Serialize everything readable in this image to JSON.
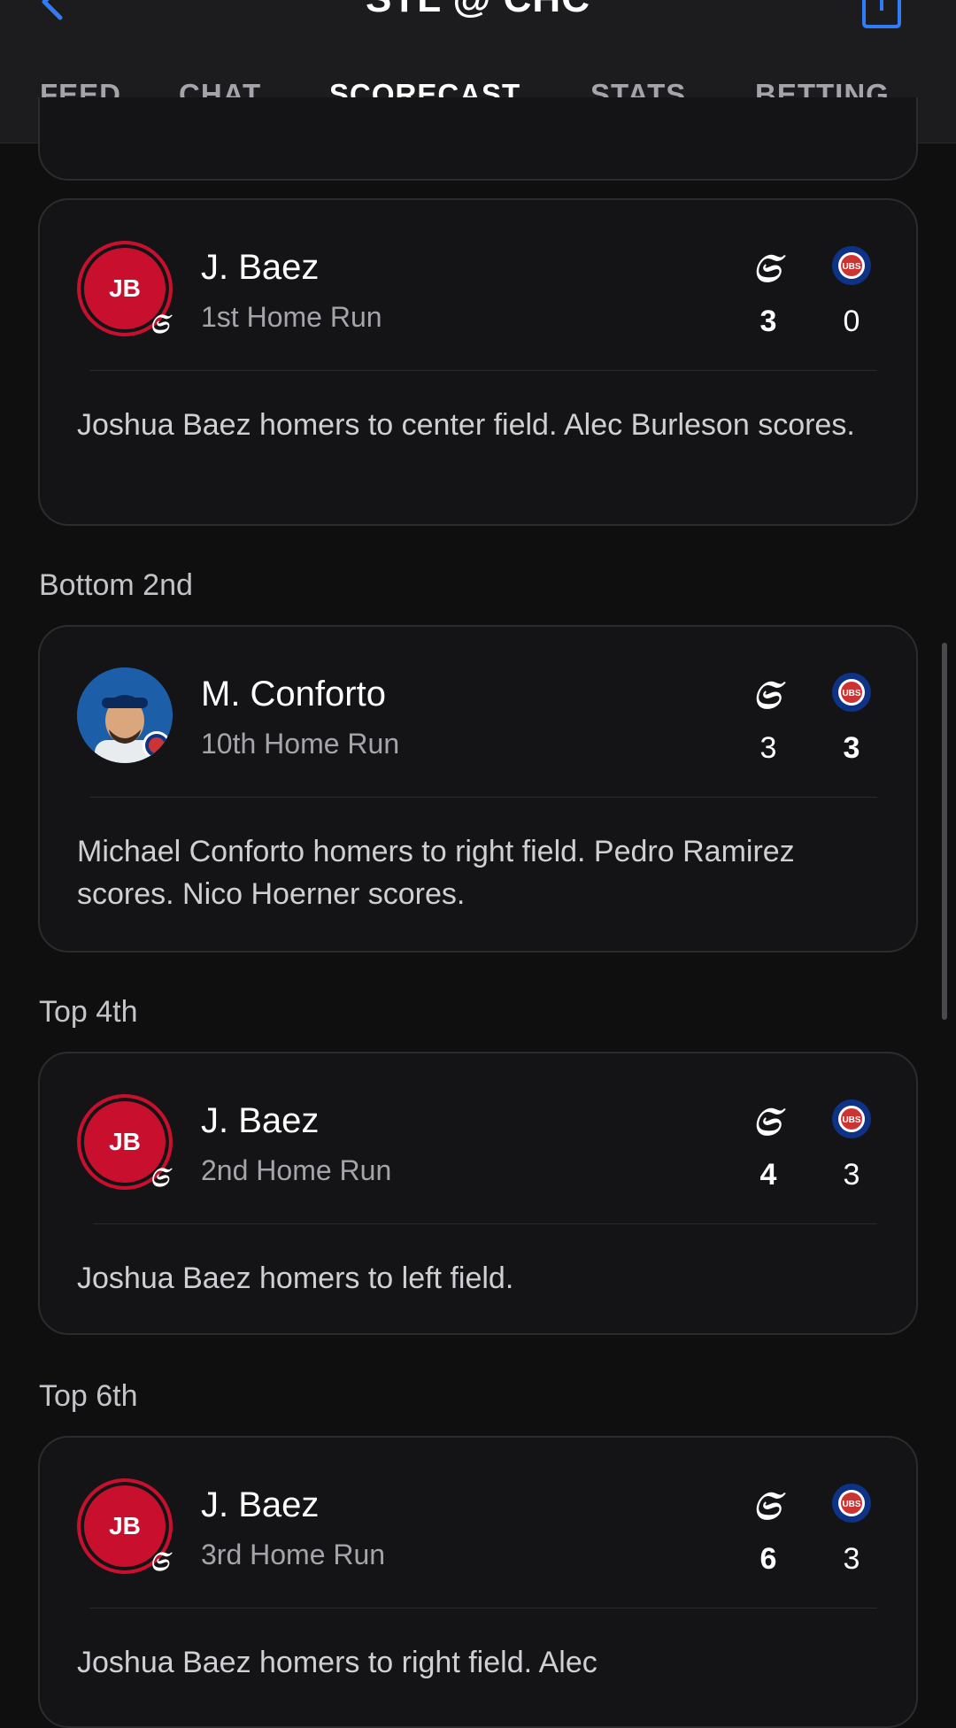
{
  "header": {
    "title": "STL @ CHC",
    "tabs": [
      "FEED",
      "CHAT",
      "SCORECAST",
      "STATS",
      "BETTING"
    ],
    "active_tab": "SCORECAST",
    "accent_color": "#2f7cf6"
  },
  "teams": {
    "away": {
      "abbr": "STL",
      "color": "#c8102e",
      "icon": "cardinals-logo"
    },
    "home": {
      "abbr": "CHC",
      "color": "#0e3386",
      "icon": "cubs-logo"
    }
  },
  "plays": [
    {
      "section": "",
      "player_short": "J. Baez",
      "initials": "JB",
      "event": "1st Home Run",
      "team": "STL",
      "score_stl": "3",
      "score_chc": "0",
      "description": "Joshua Baez homers to center field. Alec Burleson scores."
    },
    {
      "section": "Bottom 2nd",
      "player_short": "M. Conforto",
      "initials": "",
      "event": "10th Home Run",
      "team": "CHC",
      "score_stl": "3",
      "score_chc": "3",
      "description": "Michael Conforto homers to right field. Pedro Ramirez scores. Nico Hoerner scores."
    },
    {
      "section": "Top 4th",
      "player_short": "J. Baez",
      "initials": "JB",
      "event": "2nd Home Run",
      "team": "STL",
      "score_stl": "4",
      "score_chc": "3",
      "description": "Joshua Baez homers to left field."
    },
    {
      "section": "Top 6th",
      "player_short": "J. Baez",
      "initials": "JB",
      "event": "3rd Home Run",
      "team": "STL",
      "score_stl": "6",
      "score_chc": "3",
      "description": "Joshua Baez homers to right field. Alec"
    }
  ]
}
